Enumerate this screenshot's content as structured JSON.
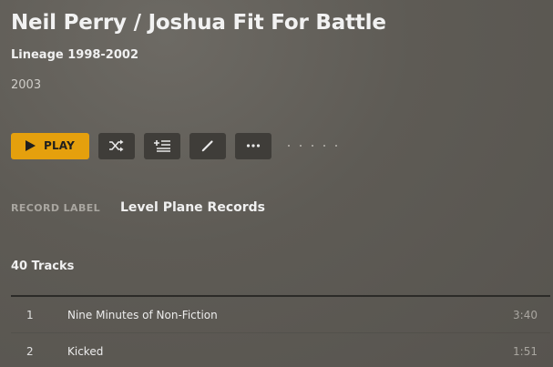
{
  "album": {
    "title": "Neil Perry / Joshua Fit For Battle",
    "subtitle": "Lineage 1998-2002",
    "year": "2003"
  },
  "toolbar": {
    "play_label": "PLAY",
    "play_color": "#e5a00d",
    "icons": [
      "shuffle-icon",
      "add-to-queue-icon",
      "edit-icon",
      "more-icon"
    ]
  },
  "metadata": {
    "record_label_key": "RECORD LABEL",
    "record_label_value": "Level Plane Records"
  },
  "tracks": {
    "heading": "40 Tracks",
    "items": [
      {
        "number": "1",
        "title": "Nine Minutes of Non-Fiction",
        "duration": "3:40"
      },
      {
        "number": "2",
        "title": "Kicked",
        "duration": "1:51"
      }
    ]
  }
}
